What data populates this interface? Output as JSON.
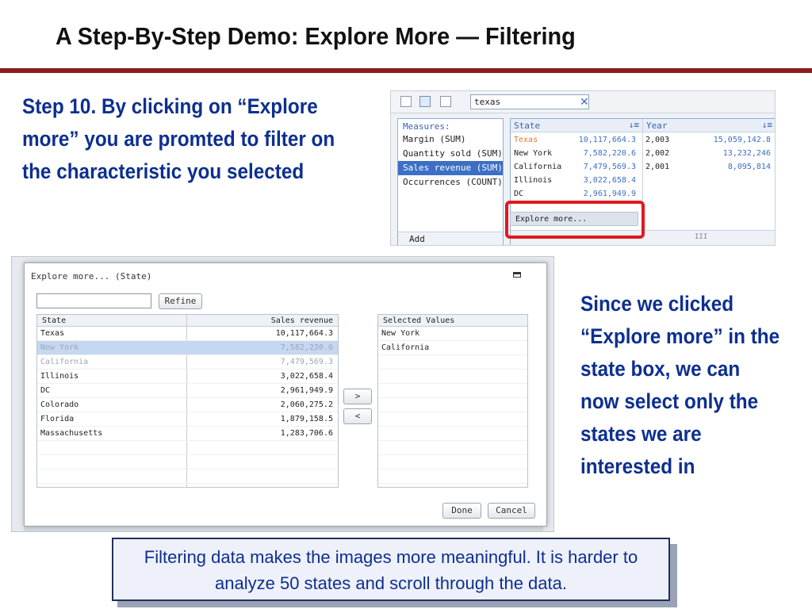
{
  "slide": {
    "title": "A Step-By-Step Demo: Explore More — Filtering",
    "step_text": "Step 10. By clicking on “Explore more” you are promted to filter on the characteristic you selected",
    "side_text": "Since we clicked “Explore more” in the state box, we can now select only the states we are interested in",
    "callout": "Filtering data makes the images more meaningful. It is harder to analyze 50 states and scroll through the data.",
    "accent_color": "#8a1d1d",
    "text_color": "#0d2f8f"
  },
  "top_screen": {
    "search_value": "texas",
    "clear_icon": "close-icon",
    "measures": {
      "header": "Measures:",
      "items": [
        "Margin (SUM)",
        "Quantity sold (SUM)",
        "Sales revenue (SUM)",
        "Occurrences (COUNT)"
      ],
      "selected_index": 2,
      "add_calculation": "Add Calculation..."
    },
    "state_column": {
      "header": "State",
      "rows": [
        {
          "name": "Texas",
          "value": "10,117,664.3"
        },
        {
          "name": "New York",
          "value": "7,582,220.6"
        },
        {
          "name": "California",
          "value": "7,479,569.3"
        },
        {
          "name": "Illinois",
          "value": "3,022,658.4"
        },
        {
          "name": "DC",
          "value": "2,961,949.9"
        }
      ]
    },
    "year_column": {
      "header": "Year",
      "rows": [
        {
          "year": "2,003",
          "value": "15,059,142.8"
        },
        {
          "year": "2,002",
          "value": "13,232,246"
        },
        {
          "year": "2,001",
          "value": "8,095,814"
        }
      ]
    },
    "context_menu_item": "Explore more...",
    "scroll_indicator": "III"
  },
  "dialog": {
    "title": "Explore more... (State)",
    "filter_value": "",
    "refine_label": "Refine",
    "available": {
      "headers": [
        "State",
        "Sales revenue"
      ],
      "rows": [
        {
          "state": "Texas",
          "revenue": "10,117,664.3",
          "state_class": ""
        },
        {
          "state": "New York",
          "revenue": "7,582,220.6",
          "state_class": "dim"
        },
        {
          "state": "California",
          "revenue": "7,479,569.3",
          "state_class": "dim"
        },
        {
          "state": "Illinois",
          "revenue": "3,022,658.4",
          "state_class": ""
        },
        {
          "state": "DC",
          "revenue": "2,961,949.9",
          "state_class": ""
        },
        {
          "state": "Colorado",
          "revenue": "2,060,275.2",
          "state_class": ""
        },
        {
          "state": "Florida",
          "revenue": "1,879,158.5",
          "state_class": ""
        },
        {
          "state": "Massachusetts",
          "revenue": "1,283,706.6",
          "state_class": ""
        }
      ],
      "selected_index": 1
    },
    "add_label": ">",
    "remove_label": "<",
    "selected": {
      "header": "Selected Values",
      "rows": [
        "New York",
        "California"
      ]
    },
    "done_label": "Done",
    "cancel_label": "Cancel"
  }
}
